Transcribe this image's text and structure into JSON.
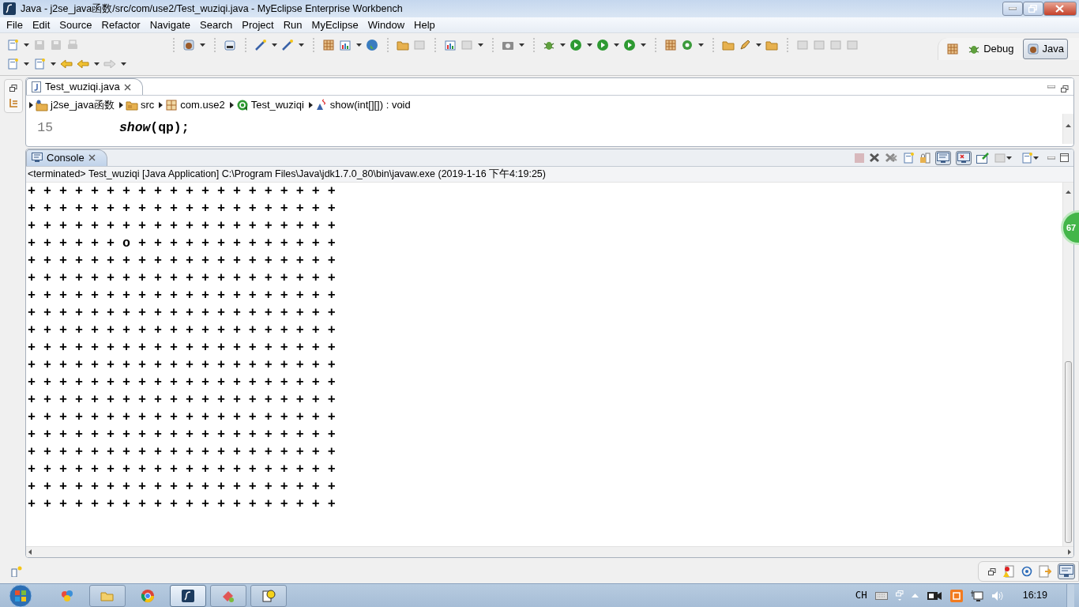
{
  "window": {
    "title": "Java - j2se_java函数/src/com/use2/Test_wuziqi.java - MyEclipse Enterprise Workbench"
  },
  "menu": [
    "File",
    "Edit",
    "Source",
    "Refactor",
    "Navigate",
    "Search",
    "Project",
    "Run",
    "MyEclipse",
    "Window",
    "Help"
  ],
  "perspectives": [
    {
      "label": "Debug",
      "selected": false
    },
    {
      "label": "Java",
      "selected": true
    }
  ],
  "editor": {
    "tabs": [
      {
        "label": "Test_wuziqi.java",
        "selected": true
      }
    ],
    "breadcrumb": [
      {
        "kind": "project",
        "label": "j2se_java函数"
      },
      {
        "kind": "folder",
        "label": "src"
      },
      {
        "kind": "package",
        "label": "com.use2"
      },
      {
        "kind": "class",
        "label": "Test_wuziqi"
      },
      {
        "kind": "method",
        "label": "show(int[][]) : void"
      }
    ],
    "lines": [
      {
        "number": "15",
        "code": "*show*(qp);"
      }
    ]
  },
  "console": {
    "tabs": [
      {
        "label": "Console",
        "selected": true
      }
    ],
    "toggles": [
      {
        "selected": true
      },
      {
        "selected": true
      }
    ],
    "status": "<terminated> Test_wuziqi [Java Application] C:\\Program Files\\Java\\jdk1.7.0_80\\bin\\javaw.exe (2019-1-16 下午4:19:25)",
    "output": [
      "+ + + + + + + + + + + + + + + + + + + +",
      "+ + + + + + + + + + + + + + + + + + + +",
      "+ + + + + + + + + + + + + + + + + + + +",
      "+ + + + + + o + + + + + + + + + + + + +",
      "+ + + + + + + + + + + + + + + + + + + +",
      "+ + + + + + + + + + + + + + + + + + + +",
      "+ + + + + + + + + + + + + + + + + + + +",
      "+ + + + + + + + + + + + + + + + + + + +",
      "+ + + + + + + + + + + + + + + + + + + +",
      "+ + + + + + + + + + + + + + + + + + + +",
      "+ + + + + + + + + + + + + + + + + + + +",
      "+ + + + + + + + + + + + + + + + + + + +",
      "+ + + + + + + + + + + + + + + + + + + +",
      "+ + + + + + + + + + + + + + + + + + + +",
      "+ + + + + + + + + + + + + + + + + + + +",
      "+ + + + + + + + + + + + + + + + + + + +",
      "+ + + + + + + + + + + + + + + + + + + +",
      "+ + + + + + + + + + + + + + + + + + + +",
      "+ + + + + + + + + + + + + + + + + + + +"
    ]
  },
  "floating_badge": "67",
  "taskbar": {
    "apps": [
      {
        "kind": "palette",
        "selected": false
      },
      {
        "kind": "explorer",
        "selected": false
      },
      {
        "kind": "browser",
        "selected": false
      },
      {
        "kind": "ide",
        "selected": true
      },
      {
        "kind": "tool",
        "selected": false
      },
      {
        "kind": "help",
        "selected": false
      }
    ],
    "input_language": "CH",
    "clock": "16:19"
  }
}
